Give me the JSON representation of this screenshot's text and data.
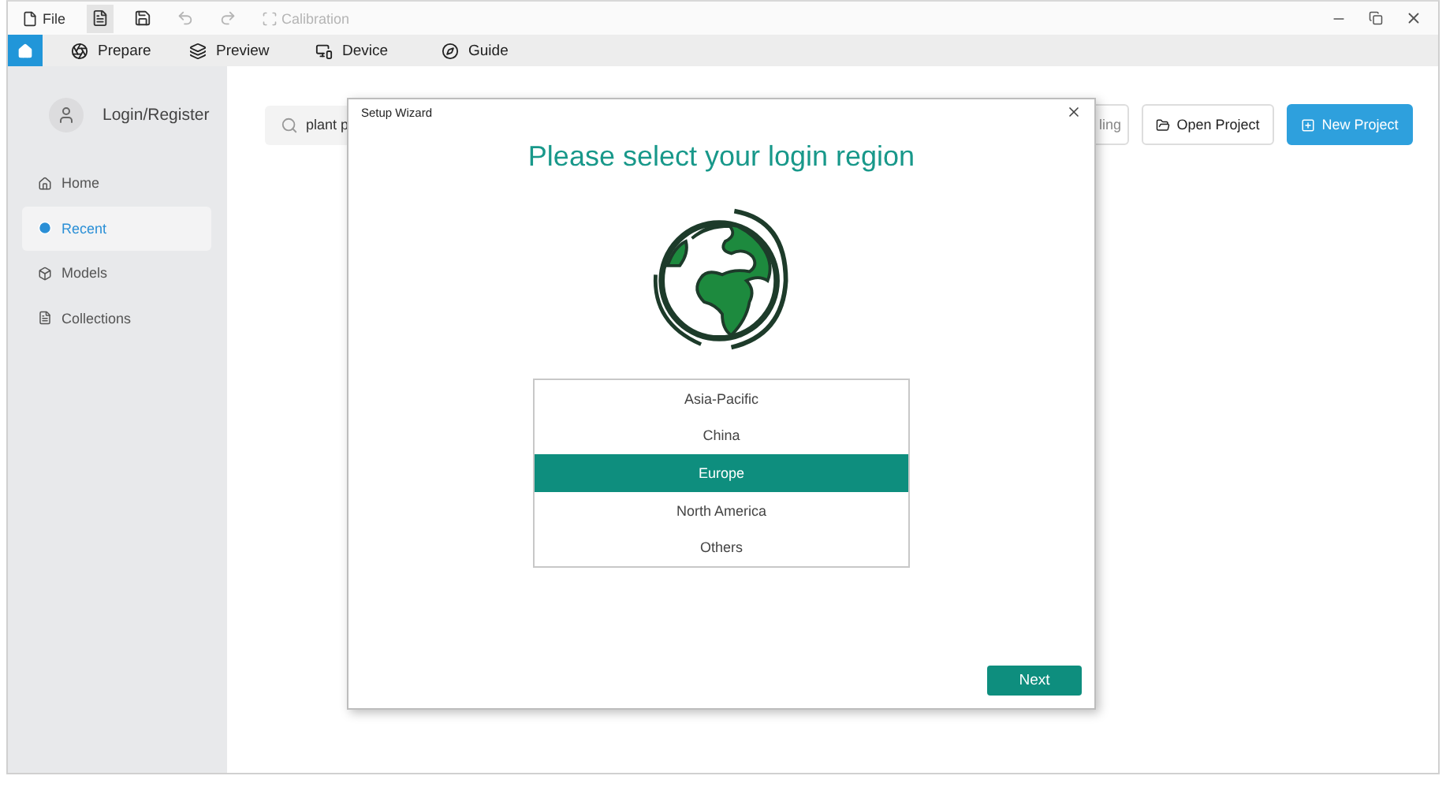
{
  "menu_bar": {
    "file_label": "File",
    "tools": [
      {
        "kind": "list",
        "selected": true,
        "disabled": false
      },
      {
        "kind": "save",
        "selected": false,
        "disabled": false
      },
      {
        "kind": "undo",
        "selected": false,
        "disabled": true
      },
      {
        "kind": "redo",
        "selected": false,
        "disabled": true
      }
    ],
    "calibration": {
      "label": "Calibration",
      "disabled": true
    }
  },
  "tabs": [
    {
      "kind": "home",
      "selected": true
    },
    {
      "kind": "prepare",
      "label": "Prepare",
      "selected": false
    },
    {
      "kind": "preview",
      "label": "Preview",
      "selected": false
    },
    {
      "kind": "device",
      "label": "Device",
      "selected": false
    },
    {
      "kind": "guide",
      "label": "Guide",
      "selected": false
    }
  ],
  "sidebar": {
    "account": "Login/Register",
    "items": [
      {
        "kind": "home",
        "label": "Home",
        "selected": false
      },
      {
        "kind": "recent",
        "label": "Recent",
        "selected": true
      },
      {
        "kind": "models",
        "label": "Models",
        "selected": false
      },
      {
        "kind": "collections",
        "label": "Collections",
        "selected": false
      }
    ]
  },
  "toolbar": {
    "search": {
      "value": "plant p"
    },
    "buttons": [
      {
        "kind": "hidden",
        "label": "ling"
      },
      {
        "kind": "open",
        "label": "Open Project"
      },
      {
        "kind": "new",
        "label": "New Project"
      }
    ]
  },
  "dialog": {
    "title": "Setup Wizard",
    "heading": "Please select your login region",
    "regions": [
      {
        "label": "Asia-Pacific",
        "selected": false
      },
      {
        "label": "China",
        "selected": false
      },
      {
        "label": "Europe",
        "selected": true
      },
      {
        "label": "North America",
        "selected": false
      },
      {
        "label": "Others",
        "selected": false
      }
    ],
    "next_button": "Next"
  }
}
